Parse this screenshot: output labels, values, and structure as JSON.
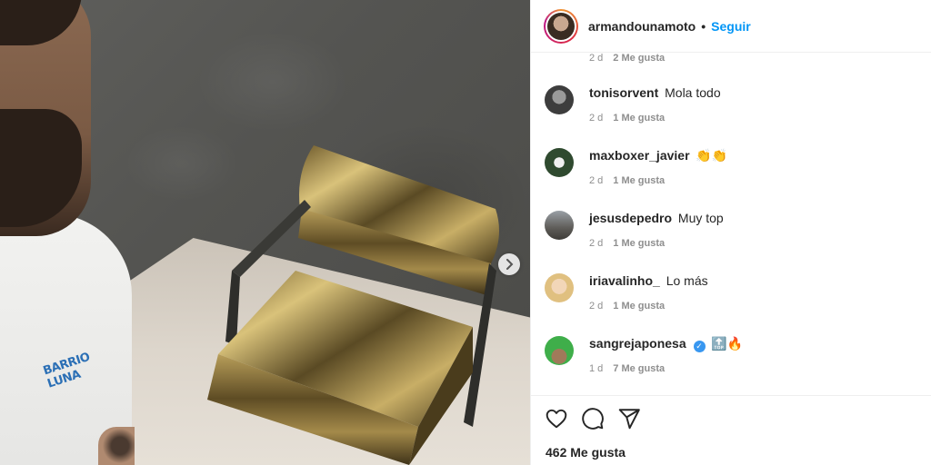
{
  "post": {
    "owner": "armandounamoto",
    "separator": "•",
    "follow_label": "Seguir",
    "shirt_print": "BARRIO LUNA",
    "top_meta": {
      "time": "2 d",
      "likes": "2 Me gusta"
    }
  },
  "comments": [
    {
      "user": "tonisorvent",
      "text": "Mola todo",
      "time": "2 d",
      "likes": "1 Me gusta",
      "avatar_color": "#4a4a4a"
    },
    {
      "user": "maxboxer_javier",
      "text": "👏👏",
      "time": "2 d",
      "likes": "1 Me gusta",
      "avatar_color": "#3c5a3c"
    },
    {
      "user": "jesusdepedro",
      "text": "Muy top",
      "time": "2 d",
      "likes": "1 Me gusta",
      "avatar_color": "#6d6a64"
    },
    {
      "user": "iriavalinho_",
      "text": "Lo más",
      "time": "2 d",
      "likes": "1 Me gusta",
      "avatar_color": "#d9b48a"
    },
    {
      "user": "sangrejaponesa",
      "text": "🔝🔥",
      "time": "1 d",
      "likes": "7 Me gusta",
      "avatar_color": "#3fae4a",
      "verified": true
    }
  ],
  "actions": {
    "like_icon": "heart-icon",
    "comment_icon": "comment-icon",
    "share_icon": "share-icon",
    "likes_total": "462 Me gusta"
  },
  "colors": {
    "accent": "#0095f6",
    "meta": "#8e8e8e",
    "text": "#262626"
  }
}
